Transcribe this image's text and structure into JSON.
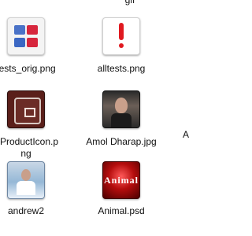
{
  "files": {
    "top_cut_label": "gif",
    "edge_cut_label": "A",
    "items": [
      {
        "label": "tests_orig.png",
        "icon": "tests-icon"
      },
      {
        "label": "alltests.png",
        "icon": "exclamation-icon"
      },
      {
        "label": "EProductIcon.p\nng",
        "icon": "product-icon"
      },
      {
        "label": "Amol Dharap.jpg",
        "icon": "photo-icon"
      },
      {
        "label": "andrew2",
        "icon": "photo-icon"
      },
      {
        "label": "Animal.psd",
        "icon": "photoshop-image-icon",
        "icon_text": "Animal"
      }
    ]
  },
  "colors": {
    "warning_red": "#e01920",
    "product_brown": "#5a1f1a"
  }
}
